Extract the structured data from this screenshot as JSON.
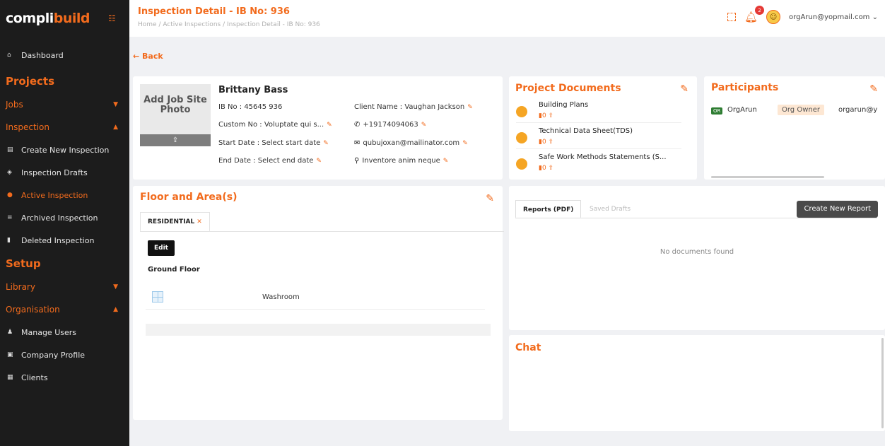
{
  "brand": {
    "part1": "compli",
    "part2": "build"
  },
  "sidebar": {
    "dashboard": "Dashboard",
    "projects_section": "Projects",
    "jobs": "Jobs",
    "inspection": "Inspection",
    "inspection_items": [
      {
        "label": "Create New Inspection",
        "icon": "document-icon"
      },
      {
        "label": "Inspection Drafts",
        "icon": "drafts-icon"
      },
      {
        "label": "Active Inspection",
        "icon": "dot-icon",
        "active": true
      },
      {
        "label": "Archived Inspection",
        "icon": "archive-icon"
      },
      {
        "label": "Deleted Inspection",
        "icon": "trash-icon"
      }
    ],
    "setup_section": "Setup",
    "library": "Library",
    "organisation": "Organisation",
    "org_items": [
      {
        "label": "Manage Users",
        "icon": "users-icon"
      },
      {
        "label": "Company Profile",
        "icon": "profile-icon"
      },
      {
        "label": "Clients",
        "icon": "clients-icon"
      }
    ]
  },
  "header": {
    "title": "Inspection Detail - IB No: 936",
    "breadcrumb": "Home / Active Inspections / Inspection Detail - IB No: 936",
    "notification_count": "2",
    "user_email": "orgArun@yopmail.com"
  },
  "back_label": "Back",
  "profile": {
    "photo_label": "Add Job Site Photo",
    "name": "Brittany Bass",
    "ib_no": "IB No : 45645 936",
    "custom_no": "Custom No : Voluptate qui s...",
    "start_date": "Start Date : Select start date",
    "end_date": "End Date : Select end date",
    "client_name": "Client Name : Vaughan Jackson",
    "phone": "+19174094063",
    "email": "qubujoxan@mailinator.com",
    "location": "Inventore anim neque"
  },
  "documents": {
    "title": "Project Documents",
    "items": [
      {
        "name": "Building Plans",
        "count": "0"
      },
      {
        "name": "Technical Data Sheet(TDS)",
        "count": "0"
      },
      {
        "name": "Safe Work Methods Statements (S...",
        "count": "0"
      }
    ]
  },
  "participants": {
    "title": "Participants",
    "items": [
      {
        "initials": "OR",
        "name": "OrgArun",
        "role": "Org Owner",
        "email": "orgarun@y"
      }
    ]
  },
  "floor": {
    "title": "Floor and Area(s)",
    "tab": "RESIDENTIAL",
    "edit_label": "Edit",
    "floor_name": "Ground Floor",
    "rooms": [
      {
        "name": "Washroom"
      }
    ]
  },
  "reports": {
    "tab_pdf": "Reports (PDF)",
    "tab_drafts": "Saved Drafts",
    "create_label": "Create New Report",
    "empty_text": "No documents found"
  },
  "chat": {
    "title": "Chat"
  },
  "colors": {
    "accent": "#f26b1d",
    "sidebar_bg": "#1c1c1c"
  }
}
